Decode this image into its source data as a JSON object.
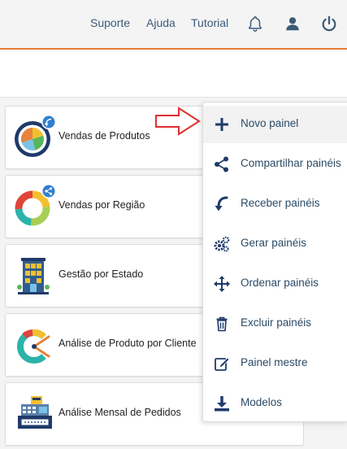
{
  "nav": {
    "support": "Suporte",
    "help": "Ajuda",
    "tutorial": "Tutorial"
  },
  "cards": [
    {
      "label": "Vendas de Produtos",
      "icon": "pie-chart-icon",
      "badge": "receive-badge-icon"
    },
    {
      "label": "Vendas por Região",
      "icon": "donut-chart-icon",
      "badge": "share-badge-icon"
    },
    {
      "label": "Gestão por Estado",
      "icon": "building-icon"
    },
    {
      "label": "Análise de Produto por Cliente",
      "icon": "ring-chart-icon"
    },
    {
      "label": "Análise Mensal de Pedidos",
      "icon": "cash-register-icon"
    }
  ],
  "menu": {
    "items": [
      {
        "label": "Novo painel",
        "icon": "plus-icon",
        "active": true
      },
      {
        "label": "Compartilhar painéis",
        "icon": "share-icon"
      },
      {
        "label": "Receber painéis",
        "icon": "receive-arrow-icon"
      },
      {
        "label": "Gerar painéis",
        "icon": "gears-icon"
      },
      {
        "label": "Ordenar painéis",
        "icon": "move-arrows-icon"
      },
      {
        "label": "Excluir painéis",
        "icon": "trash-icon"
      },
      {
        "label": "Painel mestre",
        "icon": "edit-icon"
      },
      {
        "label": "Modelos",
        "icon": "download-icon"
      }
    ]
  },
  "colors": {
    "accent_orange": "#e57b3a",
    "text_blue": "#2b4a66",
    "badge_blue": "#2f7fd0",
    "pointer_arrow": "#e03030"
  }
}
